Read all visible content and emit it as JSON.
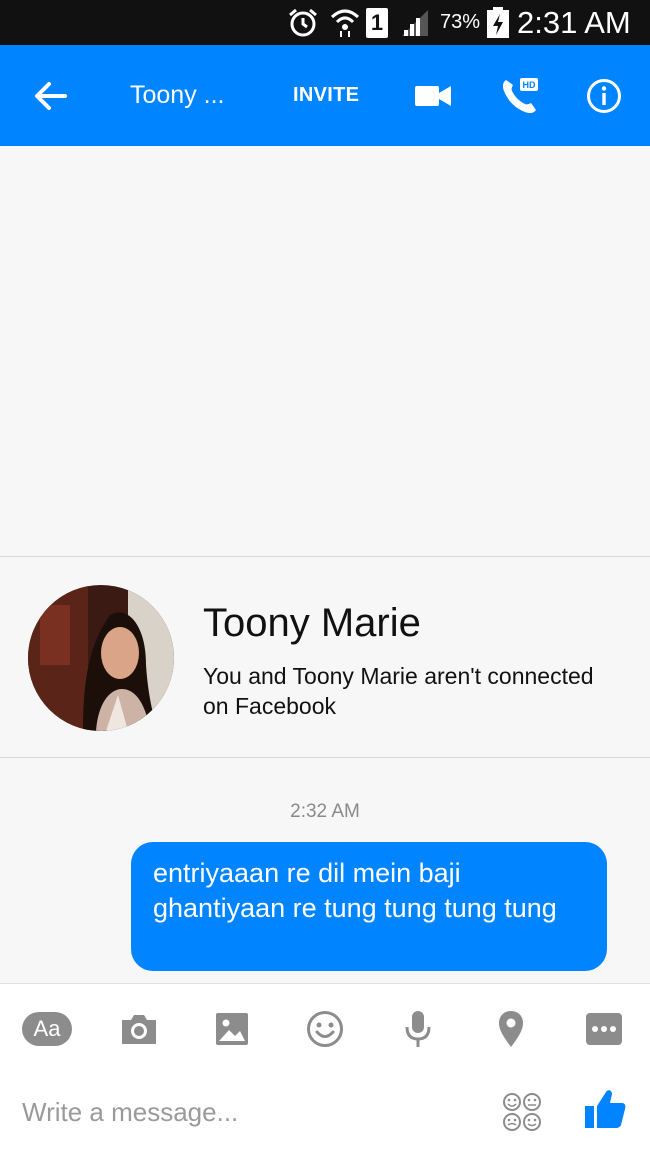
{
  "status_bar": {
    "battery_percent": "73%",
    "time": "2:31 AM",
    "sim_label": "1",
    "icons": [
      "alarm-icon",
      "wifi-icon",
      "sim-icon",
      "signal-icon",
      "battery-charging-icon"
    ]
  },
  "header": {
    "title": "Toony ...",
    "invite_label": "INVITE",
    "call_hd_label": "HD",
    "icons": [
      "back-arrow-icon",
      "video-camera-icon",
      "phone-hd-icon",
      "info-icon"
    ],
    "accent_color": "#0084ff"
  },
  "profile": {
    "name": "Toony Marie",
    "subtitle": "You and Toony Marie aren't connected on Facebook"
  },
  "conversation": {
    "timestamp": "2:32 AM",
    "messages": [
      {
        "sender": "me",
        "text": "entriyaaan re dil mein baji ghantiyaan re tung tung tung tung"
      }
    ]
  },
  "composer": {
    "text_button_label": "Aa",
    "placeholder": "Write a message...",
    "icons": [
      "text-aa-icon",
      "camera-icon",
      "gallery-icon",
      "emoji-icon",
      "microphone-icon",
      "location-pin-icon",
      "more-icon",
      "stickers-icon",
      "thumbs-up-icon"
    ]
  }
}
